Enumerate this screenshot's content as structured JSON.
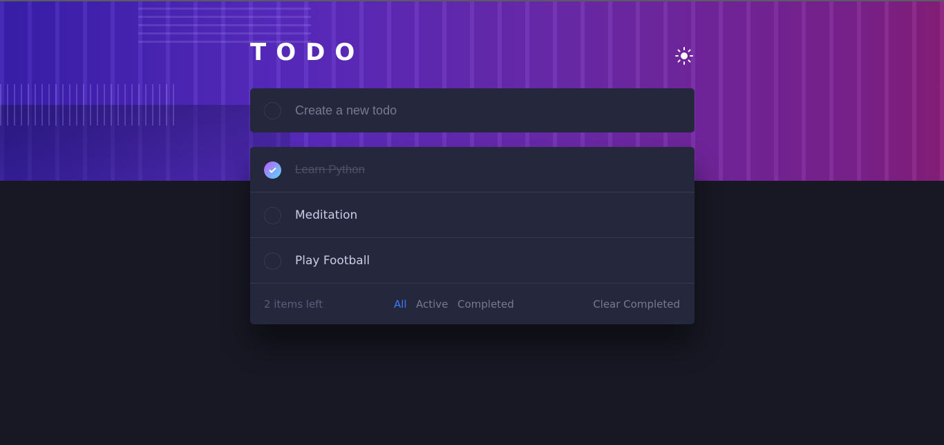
{
  "app": {
    "title": "TODO"
  },
  "new_todo": {
    "placeholder": "Create a new todo"
  },
  "todos": [
    {
      "text": "Learn Python",
      "completed": true
    },
    {
      "text": "Meditation",
      "completed": false
    },
    {
      "text": "Play Football",
      "completed": false
    }
  ],
  "footer": {
    "items_left": "2 items left",
    "filters": {
      "all": "All",
      "active": "Active",
      "completed": "Completed",
      "selected": "All"
    },
    "clear_label": "Clear Completed"
  },
  "icons": {
    "theme_toggle": "sun-icon",
    "check": "check-icon"
  },
  "colors": {
    "accent": "#3a7cfd",
    "check_gradient_start": "#c058f3",
    "check_gradient_end": "#55ddff",
    "card": "#25273c",
    "background": "#181824"
  }
}
